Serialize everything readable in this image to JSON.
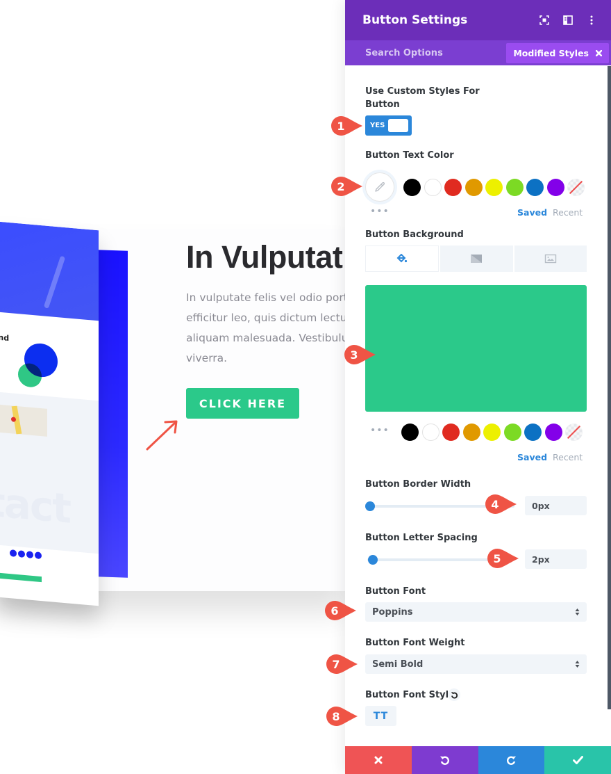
{
  "preview": {
    "mock_heading": "and",
    "mock_bigword": "tact",
    "hero_title": "In Vulputat",
    "hero_body_lines": [
      "In vulputate felis vel odio portt",
      "efficitur leo, quis dictum lectus",
      "aliquam malesuada. Vestibulu",
      "viverra."
    ],
    "cta_label": "CLICK HERE"
  },
  "panel": {
    "title": "Button Settings",
    "header_icons": [
      "focus-icon",
      "sidebar-layout-icon",
      "more-vertical-icon"
    ],
    "search_placeholder": "Search Options",
    "filter_badge": "Modified Styles",
    "fields": {
      "custom_styles": {
        "label": "Use Custom Styles For",
        "label_line2": "Button",
        "toggle_value": "YES",
        "enabled": true
      },
      "text_color": {
        "label": "Button Text Color",
        "saved_tab": "Saved",
        "recent_tab": "Recent",
        "more": "•••"
      },
      "background": {
        "label": "Button Background",
        "tabs": [
          "color-icon",
          "gradient-icon",
          "image-icon"
        ],
        "active_tab": "color",
        "color": "#2bc98a",
        "saved_tab": "Saved",
        "recent_tab": "Recent",
        "more": "•••"
      },
      "border_width": {
        "label": "Button Border Width",
        "value": "0px",
        "slider_fraction": 0.0
      },
      "letter_spacing": {
        "label": "Button Letter Spacing",
        "value": "2px",
        "slider_fraction": 0.02
      },
      "font": {
        "label": "Button Font",
        "value": "Poppins"
      },
      "font_weight": {
        "label": "Button Font Weight",
        "value": "Semi Bold"
      },
      "font_style": {
        "label": "Button Font Style",
        "button_label": "TT"
      }
    },
    "palette": [
      "#000000",
      "#ffffff",
      "#e02b20",
      "#e09900",
      "#edf000",
      "#7cda24",
      "#0c71c3",
      "#8300e9",
      "none"
    ],
    "footer": [
      "cancel",
      "undo",
      "redo",
      "save"
    ]
  },
  "callouts": [
    "1",
    "2",
    "3",
    "4",
    "5",
    "6",
    "7",
    "8"
  ],
  "colors": {
    "header": "#6c2eb9",
    "subheader": "#7b3ed1",
    "accent_blue": "#2b87da",
    "button_green": "#2bc98a",
    "marker_red": "#ef5445"
  }
}
